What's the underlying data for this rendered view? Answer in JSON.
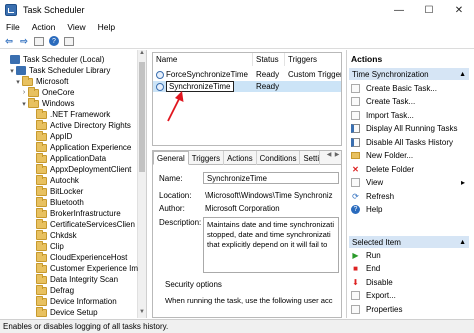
{
  "window": {
    "title": "Task Scheduler",
    "controls": [
      "—",
      "☐",
      "✕"
    ]
  },
  "menu": [
    "File",
    "Action",
    "View",
    "Help"
  ],
  "toolbar": {
    "back_glyph": "⇦",
    "forward_glyph": "⇨",
    "help_glyph": "?"
  },
  "tree": {
    "items": [
      {
        "label": "Task Scheduler (Local)",
        "icon": "task-scheduler-icon",
        "expander": ""
      },
      {
        "label": "Task Scheduler Library",
        "icon": "task-library-icon",
        "expander": "▾"
      },
      {
        "label": "Microsoft",
        "icon": "folder-icon",
        "expander": "▾"
      },
      {
        "label": "OneCore",
        "icon": "folder-icon",
        "expander": "›"
      },
      {
        "label": "Windows",
        "icon": "folder-icon",
        "expander": "▾"
      },
      {
        "label": ".NET Framework",
        "icon": "folder-icon",
        "expander": ""
      },
      {
        "label": "Active Directory Rights",
        "icon": "folder-icon",
        "expander": ""
      },
      {
        "label": "AppID",
        "icon": "folder-icon",
        "expander": ""
      },
      {
        "label": "Application Experience",
        "icon": "folder-icon",
        "expander": ""
      },
      {
        "label": "ApplicationData",
        "icon": "folder-icon",
        "expander": ""
      },
      {
        "label": "AppxDeploymentClient",
        "icon": "folder-icon",
        "expander": ""
      },
      {
        "label": "Autochk",
        "icon": "folder-icon",
        "expander": ""
      },
      {
        "label": "BitLocker",
        "icon": "folder-icon",
        "expander": ""
      },
      {
        "label": "Bluetooth",
        "icon": "folder-icon",
        "expander": ""
      },
      {
        "label": "BrokerInfrastructure",
        "icon": "folder-icon",
        "expander": ""
      },
      {
        "label": "CertificateServicesClien",
        "icon": "folder-icon",
        "expander": ""
      },
      {
        "label": "Chkdsk",
        "icon": "folder-icon",
        "expander": ""
      },
      {
        "label": "Clip",
        "icon": "folder-icon",
        "expander": ""
      },
      {
        "label": "CloudExperienceHost",
        "icon": "folder-icon",
        "expander": ""
      },
      {
        "label": "Customer Experience Im",
        "icon": "folder-icon",
        "expander": ""
      },
      {
        "label": "Data Integrity Scan",
        "icon": "folder-icon",
        "expander": ""
      },
      {
        "label": "Defrag",
        "icon": "folder-icon",
        "expander": ""
      },
      {
        "label": "Device Information",
        "icon": "folder-icon",
        "expander": ""
      },
      {
        "label": "Device Setup",
        "icon": "folder-icon",
        "expander": ""
      }
    ]
  },
  "tasks": {
    "columns": [
      "Name",
      "Status",
      "Triggers"
    ],
    "rows": [
      {
        "name": "ForceSynchronizeTime",
        "status": "Ready",
        "triggers": "Custom Trigger"
      },
      {
        "name": "SynchronizeTime",
        "status": "Ready",
        "triggers": ""
      }
    ]
  },
  "details": {
    "tabs": [
      "General",
      "Triggers",
      "Actions",
      "Conditions",
      "Settings"
    ],
    "name_label": "Name:",
    "name_value": "SynchronizeTime",
    "location_label": "Location:",
    "location_value": "\\Microsoft\\Windows\\Time Synchroniz",
    "author_label": "Author:",
    "author_value": "Microsoft Corporation",
    "description_label": "Description:",
    "description_lines": [
      "Maintains date and time synchronizati",
      "stopped, date and time synchronizati",
      "that explicitly depend on it will fail to"
    ],
    "security_label": "Security options",
    "security_text": "When running the task, use the following user acc"
  },
  "actions": {
    "header": "Actions",
    "group1": "Time Synchronization",
    "items1": [
      {
        "label": "Create Basic Task...",
        "icon": "create-basic-task-icon",
        "glyph": ""
      },
      {
        "label": "Create Task...",
        "icon": "create-task-icon",
        "glyph": ""
      },
      {
        "label": "Import Task...",
        "icon": "import-task-icon",
        "glyph": ""
      },
      {
        "label": "Display All Running Tasks",
        "icon": "running-tasks-icon",
        "glyph": ""
      },
      {
        "label": "Disable All Tasks History",
        "icon": "history-icon",
        "glyph": ""
      },
      {
        "label": "New Folder...",
        "icon": "new-folder-icon",
        "glyph": ""
      },
      {
        "label": "Delete Folder",
        "icon": "delete-icon",
        "glyph": "✕"
      },
      {
        "label": "View",
        "icon": "view-icon",
        "glyph": "",
        "submenu": "▸"
      },
      {
        "label": "Refresh",
        "icon": "refresh-icon",
        "glyph": "⟳"
      },
      {
        "label": "Help",
        "icon": "help-icon",
        "glyph": "?"
      }
    ],
    "group2": "Selected Item",
    "items2": [
      {
        "label": "Run",
        "icon": "run-icon",
        "glyph": "▶"
      },
      {
        "label": "End",
        "icon": "end-icon",
        "glyph": "■"
      },
      {
        "label": "Disable",
        "icon": "disable-icon",
        "glyph": "⬇"
      },
      {
        "label": "Export...",
        "icon": "export-icon",
        "glyph": ""
      },
      {
        "label": "Properties",
        "icon": "properties-icon",
        "glyph": ""
      }
    ]
  },
  "status_text": "Enables or disables logging of all tasks history."
}
